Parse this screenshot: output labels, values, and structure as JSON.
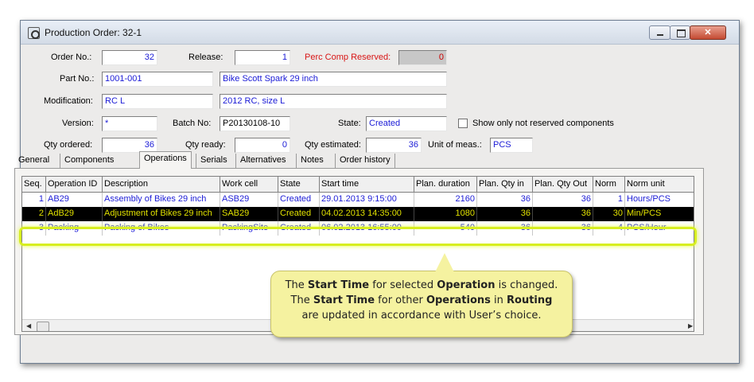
{
  "window": {
    "title": "Production Order: 32-1"
  },
  "form": {
    "order_no_label": "Order No.:",
    "order_no": "32",
    "release_label": "Release:",
    "release": "1",
    "perc_comp_label": "Perc Comp Reserved:",
    "perc_comp": "0",
    "part_no_label": "Part No.:",
    "part_no": "1001-001",
    "part_desc": "Bike Scott Spark 29 inch",
    "modification_label": "Modification:",
    "modification": "RC L",
    "modification_desc": "2012 RC, size L",
    "version_label": "Version:",
    "version": "*",
    "batch_no_label": "Batch No:",
    "batch_no": "P20130108-10",
    "state_label": "State:",
    "state": "Created",
    "show_only_label": "Show only not reserved components",
    "qty_ordered_label": "Qty ordered:",
    "qty_ordered": "36",
    "qty_ready_label": "Qty ready:",
    "qty_ready": "0",
    "qty_estimated_label": "Qty estimated:",
    "qty_estimated": "36",
    "unit_label": "Unit of meas.:",
    "unit": "PCS"
  },
  "tabs": [
    "General",
    "Components",
    "Operations",
    "Serials",
    "Alternatives",
    "Notes",
    "Order history"
  ],
  "active_tab": "Operations",
  "table": {
    "headers": [
      "Seq.",
      "Operation ID",
      "Description",
      "Work cell",
      "State",
      "Start time",
      "Plan. duration",
      "Plan. Qty in",
      "Plan. Qty Out",
      "Norm",
      "Norm unit"
    ],
    "rows": [
      [
        "1",
        "AB29",
        "Assembly of Bikes 29 inch",
        "ASB29",
        "Created",
        "29.01.2013 9:15:00",
        "2160",
        "36",
        "36",
        "1",
        "Hours/PCS"
      ],
      [
        "2",
        "AdB29",
        "Adjustment of Bikes 29 inch",
        "SAB29",
        "Created",
        "04.02.2013 14:35:00",
        "1080",
        "36",
        "36",
        "30",
        "Min/PCS"
      ],
      [
        "3",
        "Packing",
        "Packing of Bikes",
        "PackingSite",
        "Created",
        "06.02.2013 16:55:00",
        "540",
        "36",
        "36",
        "4",
        "PCS/Hour"
      ]
    ],
    "selected_row": 2
  },
  "callout": {
    "l1_a": "The ",
    "l1_b": "Start Time",
    "l1_c": " for selected ",
    "l1_d": "Operation",
    "l1_e": " is changed.",
    "l2_a": "The ",
    "l2_b": "Start Time",
    "l2_c": " for other ",
    "l2_d": "Operations",
    "l2_e": " in ",
    "l2_f": "Routing",
    "l3": "are updated in accordance with User’s choice."
  },
  "colors": {
    "field_text": "#1b1bd6",
    "selection_bg": "#000000",
    "selection_text": "#e0e000",
    "highlight": "#d7ee20",
    "callout_bg": "#f5f2a0"
  }
}
